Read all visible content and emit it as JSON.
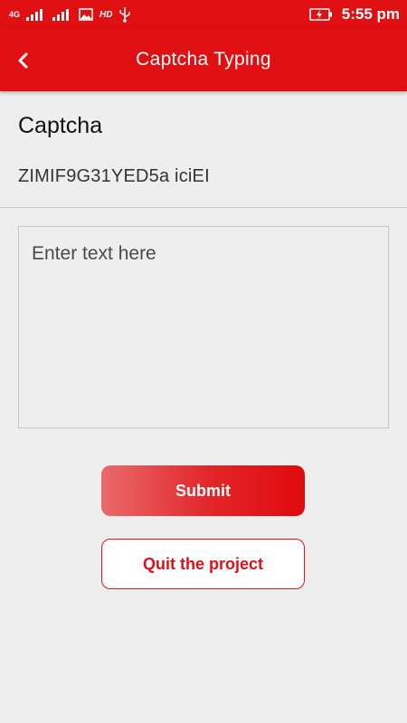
{
  "status_bar": {
    "network_1": "4G",
    "network_2": "2",
    "hd_label": "HD",
    "time": "5:55 pm",
    "icons": [
      "signal-icon",
      "image-icon",
      "usb-icon",
      "battery-charging-icon"
    ]
  },
  "app_bar": {
    "title": "Captcha Typing",
    "back_icon": "chevron-left-icon"
  },
  "captcha": {
    "label": "Captcha",
    "text": "ZIMIF9G31YED5a iciEI"
  },
  "input": {
    "placeholder": "Enter text here",
    "value": ""
  },
  "actions": {
    "submit_label": "Submit",
    "quit_label": "Quit the project"
  },
  "colors": {
    "primary": "#e00f12",
    "background": "#eeeeee",
    "quit_text": "#df1016"
  }
}
